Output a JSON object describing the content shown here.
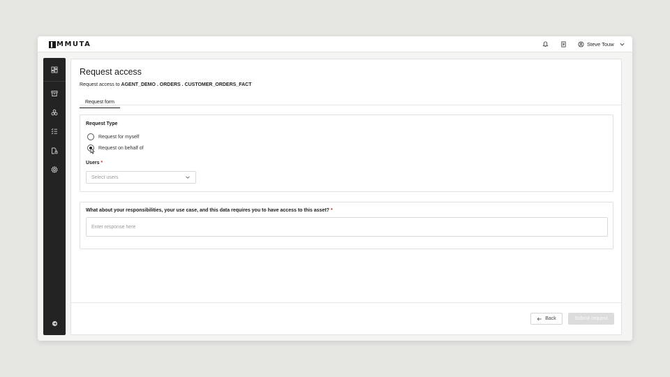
{
  "app": {
    "logo_text": "MMUTA",
    "user_name": "Steve Touw"
  },
  "topbar": {
    "icons": [
      "bell-icon",
      "notebook-icon",
      "user-circle-icon",
      "chevron-down-icon"
    ]
  },
  "sidebar": {
    "items": [
      {
        "icon": "dashboard-icon"
      },
      {
        "icon": "archive-icon"
      },
      {
        "icon": "data-products-icon"
      },
      {
        "icon": "tasks-list-icon"
      },
      {
        "icon": "file-lock-icon"
      },
      {
        "icon": "settings-icon"
      }
    ],
    "bottom_icon": "expand-arrow-icon"
  },
  "page": {
    "title": "Request access",
    "subtitle_prefix": "Request access to",
    "asset_path": "AGENT_DEMO . ORDERS . CUSTOMER_ORDERS_FACT",
    "tabs": [
      {
        "label": "Request form",
        "active": true
      }
    ]
  },
  "form": {
    "request_type": {
      "label": "Request Type",
      "options": [
        {
          "label": "Request for myself",
          "checked": false
        },
        {
          "label": "Request on behalf of",
          "checked": true
        }
      ]
    },
    "users": {
      "label": "Users",
      "required_mark": "*",
      "placeholder": "Select users"
    },
    "question": {
      "label": "What about your responsibilities, your use case, and this data requires you to have access to this asset?",
      "required_mark": "*",
      "placeholder": "Enter response here"
    }
  },
  "footer": {
    "back_label": "Back",
    "submit_label": "Submit request",
    "submit_disabled": true
  },
  "colors": {
    "sidebar_bg": "#232323",
    "required": "#c62828",
    "disabled_button": "#dcdcdc"
  }
}
